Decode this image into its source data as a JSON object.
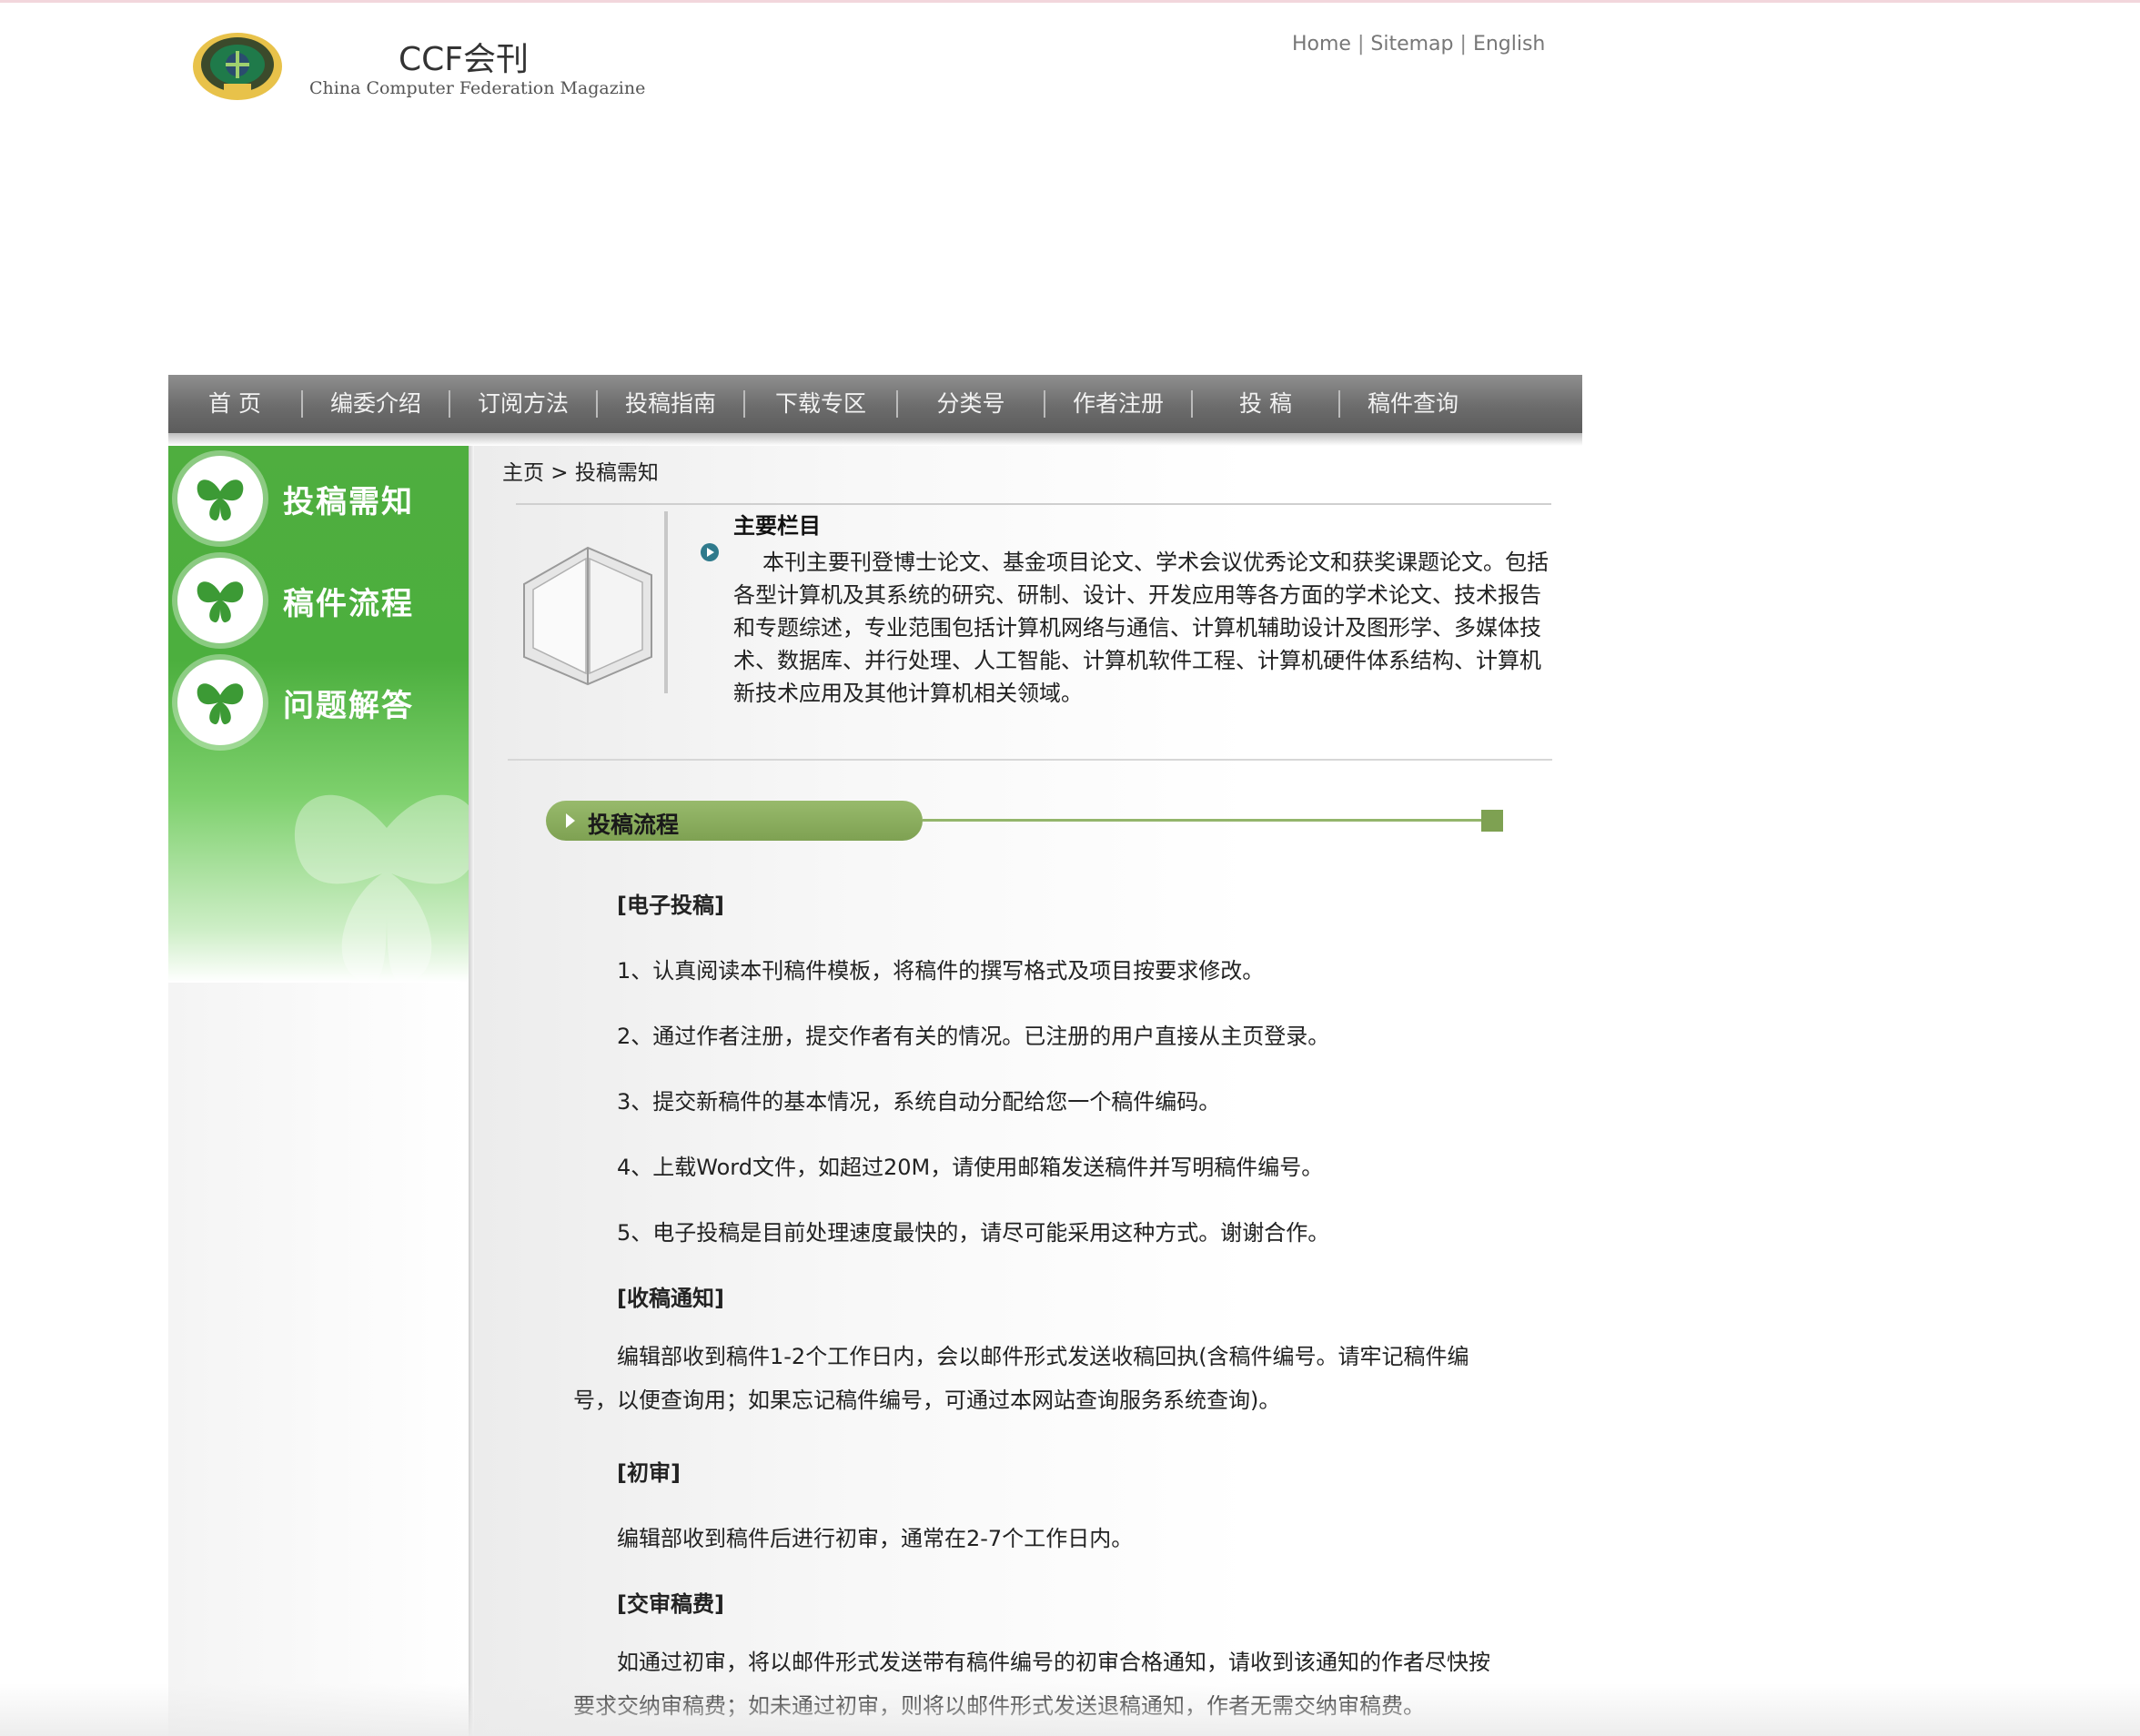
{
  "header": {
    "title": "CCF会刊",
    "subtitle": "China Computer Federation Magazine",
    "links": [
      "Home",
      "Sitemap",
      "English"
    ]
  },
  "nav": {
    "items": [
      "首 页",
      "编委介绍",
      "订阅方法",
      "投稿指南",
      "下载专区",
      "分类号",
      "作者注册",
      "投 稿",
      "稿件查询"
    ]
  },
  "sidebar": {
    "items": [
      "投稿需知",
      "稿件流程",
      "问题解答"
    ]
  },
  "breadcrumb": "主页 > 投稿需知",
  "intro": {
    "title": "主要栏目",
    "text": "本刊主要刊登博士论文、基金项目论文、学术会议优秀论文和获奖课题论文。包括各型计算机及其系统的研究、研制、设计、开发应用等各方面的学术论文、技术报告和专题综述，专业范围包括计算机网络与通信、计算机辅助设计及图形学、多媒体技术、数据库、并行处理、人工智能、计算机软件工程、计算机硬件体系结构、计算机新技术应用及其他计算机相关领域。"
  },
  "process": {
    "title": "投稿流程",
    "electronic_heading": "[电子投稿]",
    "steps": [
      "1、认真阅读本刊稿件模板，将稿件的撰写格式及项目按要求修改。",
      "2、通过作者注册，提交作者有关的情况。已注册的用户直接从主页登录。",
      "3、提交新稿件的基本情况，系统自动分配给您一个稿件编码。",
      "4、上载Word文件，如超过20M，请使用邮箱发送稿件并写明稿件编号。",
      "5、电子投稿是目前处理速度最快的，请尽可能采用这种方式。谢谢合作。"
    ],
    "receipt_heading": "[收稿通知]",
    "receipt_text": "编辑部收到稿件1-2个工作日内，会以邮件形式发送收稿回执(含稿件编号。请牢记稿件编号，以便查询用；如果忘记稿件编号，可通过本网站查询服务系统查询)。",
    "initial_heading": "[初审]",
    "initial_text": "编辑部收到稿件后进行初审，通常在2-7个工作日内。",
    "fee_heading": "[交审稿费]",
    "fee_text": "如通过初审，将以邮件形式发送带有稿件编号的初审合格通知，请收到该通知的作者尽快按要求交纳审稿费；如未通过初审，则将以邮件形式发送退稿通知，作者无需交纳审稿费。"
  },
  "colors": {
    "nav_bg": "#6c6c6c",
    "sidebar_green": "#4caf3e",
    "process_green": "#7ea152"
  },
  "icons": [
    "ccf-logo-icon",
    "butterfly-icon",
    "book-icon",
    "play-bullet-icon"
  ]
}
